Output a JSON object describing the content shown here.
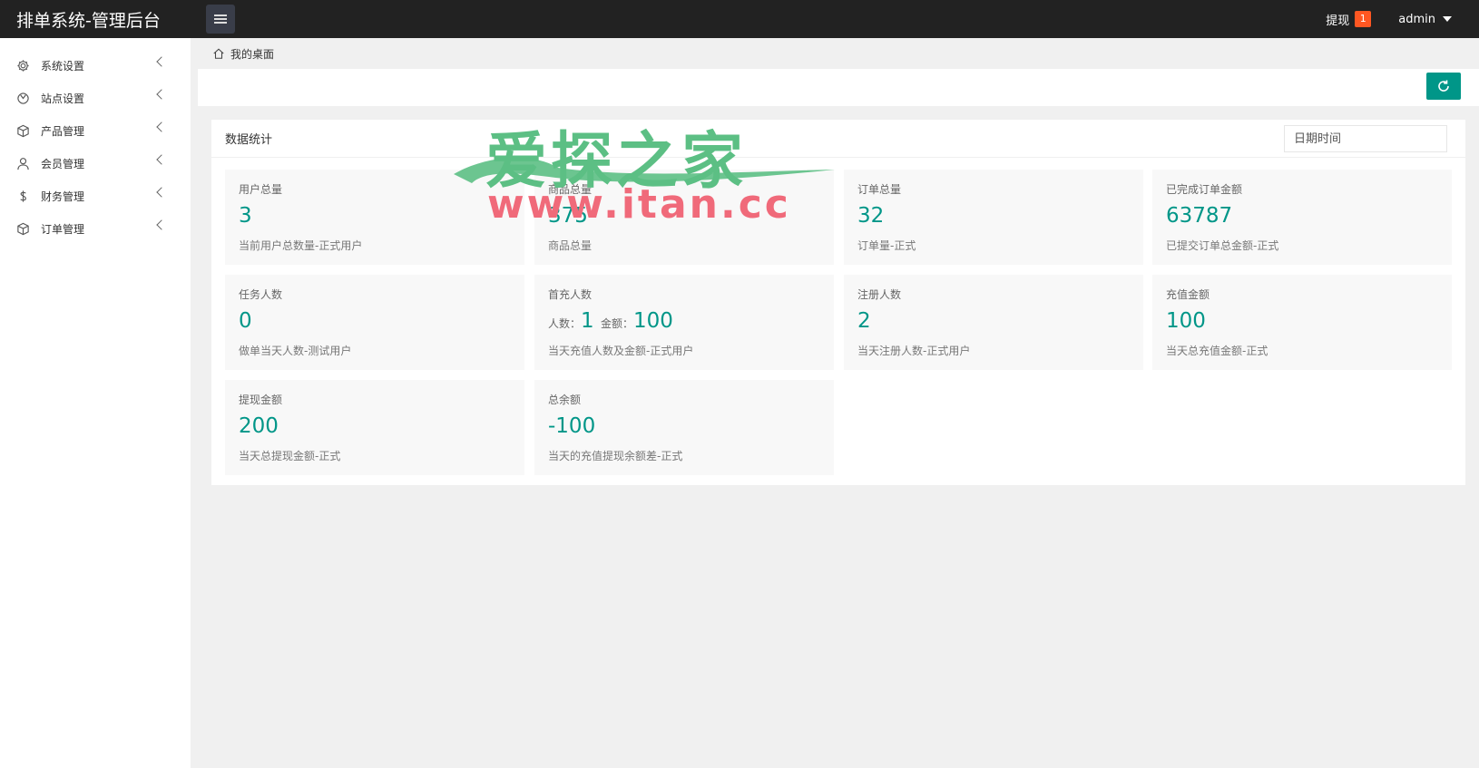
{
  "header": {
    "title": "排单系统-管理后台",
    "withdraw_label": "提现",
    "withdraw_badge": "1",
    "user": "admin"
  },
  "sidebar": {
    "items": [
      {
        "label": "系统设置",
        "icon": "gear-icon"
      },
      {
        "label": "站点设置",
        "icon": "site-icon"
      },
      {
        "label": "产品管理",
        "icon": "box-icon"
      },
      {
        "label": "会员管理",
        "icon": "user-icon"
      },
      {
        "label": "财务管理",
        "icon": "dollar-icon"
      },
      {
        "label": "订单管理",
        "icon": "box-icon"
      }
    ]
  },
  "breadcrumb": {
    "home": "我的桌面"
  },
  "panel": {
    "title": "数据统计",
    "date_placeholder": "日期时间"
  },
  "stats": [
    {
      "title": "用户总量",
      "value": "3",
      "desc": "当前用户总数量-正式用户"
    },
    {
      "title": "商品总量",
      "value": "375",
      "desc": "商品总量"
    },
    {
      "title": "订单总量",
      "value": "32",
      "desc": "订单量-正式"
    },
    {
      "title": "已完成订单金额",
      "value": "63787",
      "desc": "已提交订单总金额-正式"
    },
    {
      "title": "任务人数",
      "value": "0",
      "desc": "做单当天人数-测试用户"
    },
    {
      "title": "首充人数",
      "people_label": "人数：",
      "people": "1",
      "amount_label": "金额：",
      "amount": "100",
      "desc": "当天充值人数及金额-正式用户"
    },
    {
      "title": "注册人数",
      "value": "2",
      "desc": "当天注册人数-正式用户"
    },
    {
      "title": "充值金额",
      "value": "100",
      "desc": "当天总充值金额-正式"
    },
    {
      "title": "提现金额",
      "value": "200",
      "desc": "当天总提现金额-正式"
    },
    {
      "title": "总余额",
      "value": "-100",
      "desc": "当天的充值提现余额差-正式"
    }
  ],
  "watermark": {
    "cn": "爱探之家",
    "url": "www.itan.cc"
  },
  "colors": {
    "accent": "#009688",
    "header": "#222222",
    "badge": "#ff5722"
  }
}
